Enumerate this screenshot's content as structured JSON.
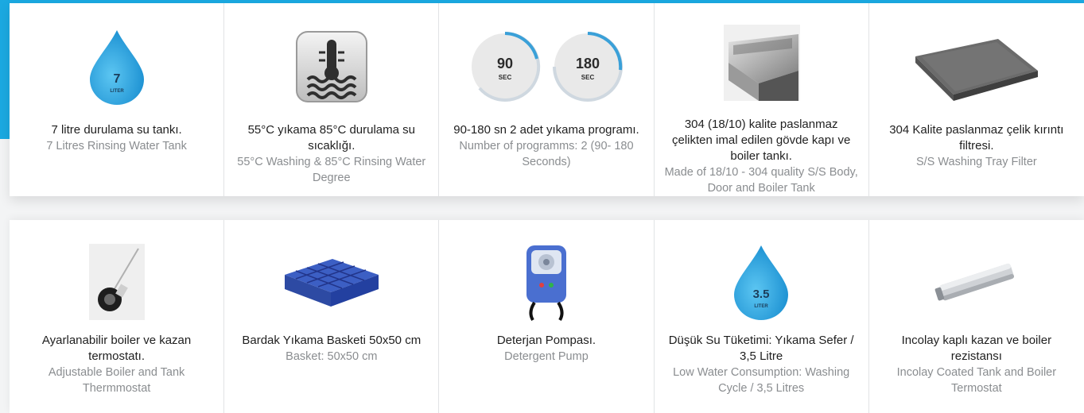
{
  "colors": {
    "accent": "#1ba9e1",
    "text": "#1f1f1f",
    "subtext": "#8a8d90"
  },
  "features_row_1": [
    {
      "icon": "water-drop-icon",
      "badge_value": "7",
      "badge_unit": "LITER",
      "tr": "7 litre durulama su tankı.",
      "en": "7 Litres Rinsing Water Tank"
    },
    {
      "icon": "water-temperature-icon",
      "tr": "55°C yıkama 85°C durulama su sıcaklığı.",
      "en": "55°C Washing & 85°C Rinsing Water Degree"
    },
    {
      "icon": "timer-programs-icon",
      "timer_1_value": "90",
      "timer_2_value": "180",
      "timer_unit": "SEC",
      "tr": "90-180 sn 2 adet yıkama programı.",
      "en": "Number of programms: 2 (90- 180 Seconds)"
    },
    {
      "icon": "stainless-body-icon",
      "tr": "304 (18/10) kalite paslanmaz çelikten imal edilen gövde kapı ve boiler tankı.",
      "en": "Made of 18/10 - 304 quality S/S Body, Door and Boiler Tank"
    },
    {
      "icon": "tray-filter-icon",
      "tr": "304 Kalite paslanmaz çelik kırıntı filtresi.",
      "en": "S/S Washing Tray Filter"
    }
  ],
  "features_row_2": [
    {
      "icon": "thermostat-icon",
      "tr": "Ayarlanabilir boiler ve kazan termostatı.",
      "en": "Adjustable Boiler and Tank Thermmostat"
    },
    {
      "icon": "glass-basket-icon",
      "tr": "Bardak Yıkama Basketi 50x50 cm",
      "en": "Basket: 50x50 cm"
    },
    {
      "icon": "detergent-pump-icon",
      "tr": "Deterjan Pompası.",
      "en": "Detergent Pump"
    },
    {
      "icon": "water-drop-icon",
      "badge_value": "3.5",
      "badge_unit": "LITER",
      "tr": "Düşük Su Tüketimi: Yıkama Sefer / 3,5 Litre",
      "en": "Low Water Consumption: Washing Cycle / 3,5 Litres"
    },
    {
      "icon": "heating-element-icon",
      "tr": "Incolay kaplı kazan ve boiler rezistansı",
      "en": "Incolay Coated Tank and Boiler Termostat"
    }
  ]
}
